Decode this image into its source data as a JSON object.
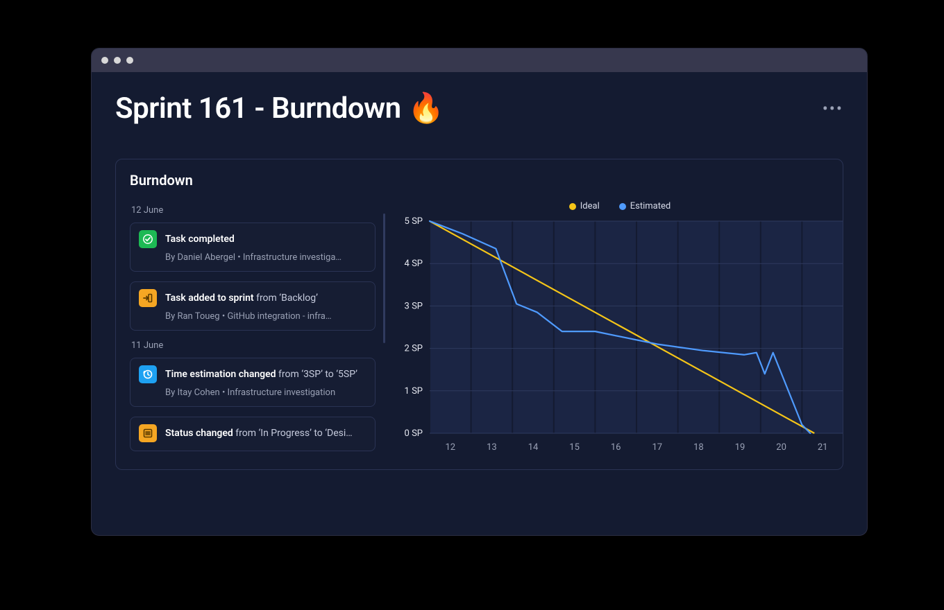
{
  "colors": {
    "ideal": "#F5C518",
    "estimated": "#4F9BFF",
    "green": "#1DB954",
    "orange": "#F5A623",
    "cyan": "#1EA1F2"
  },
  "page": {
    "title": "Sprint 161 - Burndown ",
    "emoji": "🔥"
  },
  "card": {
    "title": "Burndown"
  },
  "legend": {
    "ideal": "Ideal",
    "estimated": "Estimated"
  },
  "feed": [
    {
      "type": "date",
      "label": "12 June"
    },
    {
      "type": "event",
      "icon": "check",
      "iconbg": "#1DB954",
      "title": "Task completed",
      "suffix": "",
      "sub": "By Daniel Abergel • Infrastructure investiga…"
    },
    {
      "type": "event",
      "icon": "arrow-in",
      "iconbg": "#F5A623",
      "title": "Task added to sprint",
      "suffix": " from ‘Backlog’",
      "sub": "By Ran Toueg • GitHub integration - infra…"
    },
    {
      "type": "date",
      "label": "11 June"
    },
    {
      "type": "event",
      "icon": "clock",
      "iconbg": "#1EA1F2",
      "title": "Time estimation changed",
      "suffix": " from ‘3SP’ to ‘5SP’",
      "sub": "By Itay Cohen • Infrastructure investigation"
    },
    {
      "type": "event",
      "icon": "list",
      "iconbg": "#F5A623",
      "title": "Status changed",
      "suffix": " from ‘In Progress’ to ‘Desi…",
      "sub": ""
    }
  ],
  "chart_data": {
    "type": "line",
    "title": "Burndown",
    "xlabel": "",
    "ylabel": "",
    "ylim": [
      0,
      5
    ],
    "y_unit": "SP",
    "y_ticks": [
      "5 SP",
      "4 SP",
      "3 SP",
      "2 SP",
      "1 SP",
      "0 SP"
    ],
    "categories": [
      12,
      13,
      14,
      15,
      16,
      17,
      18,
      19,
      20,
      21
    ],
    "series": [
      {
        "name": "Ideal",
        "color": "#F5C518",
        "values": [
          5.0,
          4.44,
          3.89,
          3.33,
          2.78,
          2.22,
          1.67,
          1.11,
          0.56,
          0.0
        ]
      },
      {
        "name": "Estimated",
        "color": "#4F9BFF",
        "values": [
          5.0,
          4.7,
          4.35,
          3.05,
          2.85,
          2.4,
          2.4,
          2.1,
          1.95,
          1.85,
          1.9,
          1.4,
          1.9,
          0.2,
          0.0
        ]
      }
    ],
    "estimated_x": [
      12,
      12.8,
      13.6,
      14.1,
      14.6,
      15.2,
      16.0,
      17.5,
      18.6,
      19.6,
      19.9,
      20.1,
      20.3,
      21.0,
      21.2
    ]
  }
}
